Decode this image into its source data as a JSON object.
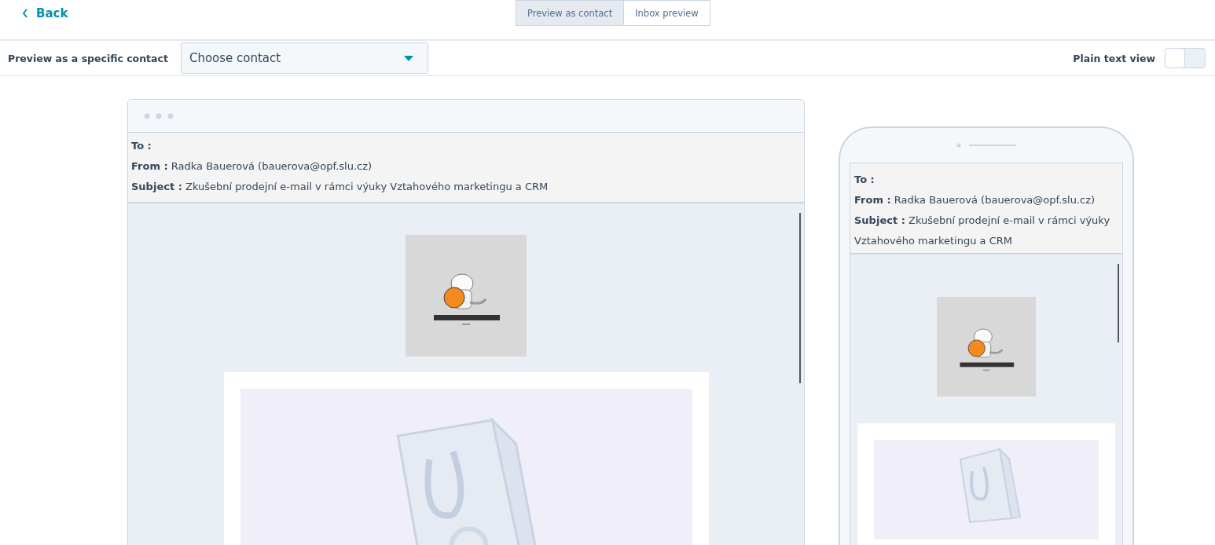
{
  "back_link": {
    "label": "Back"
  },
  "view_tabs": [
    {
      "label": "Preview as contact",
      "selected": true
    },
    {
      "label": "Inbox preview",
      "selected": false
    }
  ],
  "contact_bar": {
    "label": "Preview as a specific contact",
    "dropdown": {
      "value": "Choose contact"
    }
  },
  "plain_text_view": {
    "label": "Plain text view",
    "on": false
  },
  "desktop_preview": {
    "headers": [
      {
        "label": "To :"
      },
      {
        "label": "From :",
        "value": "Radka Bauerová (bauerova@opf.slu.cz)"
      },
      {
        "label": "Subject :",
        "value": "Zkušební prodejní e-mail v rámci výuky Vztahového marketingu a CRM"
      }
    ]
  },
  "mobile_preview": {
    "headers": [
      {
        "label": "To :"
      },
      {
        "label": "From :",
        "value": "Radka Bauerová (bauerova@opf.slu.cz)"
      },
      {
        "label": "Subject :",
        "value": "Zkušební prodejní e-mail v rámci výuky Vztahového marketingu a CRM"
      }
    ]
  }
}
